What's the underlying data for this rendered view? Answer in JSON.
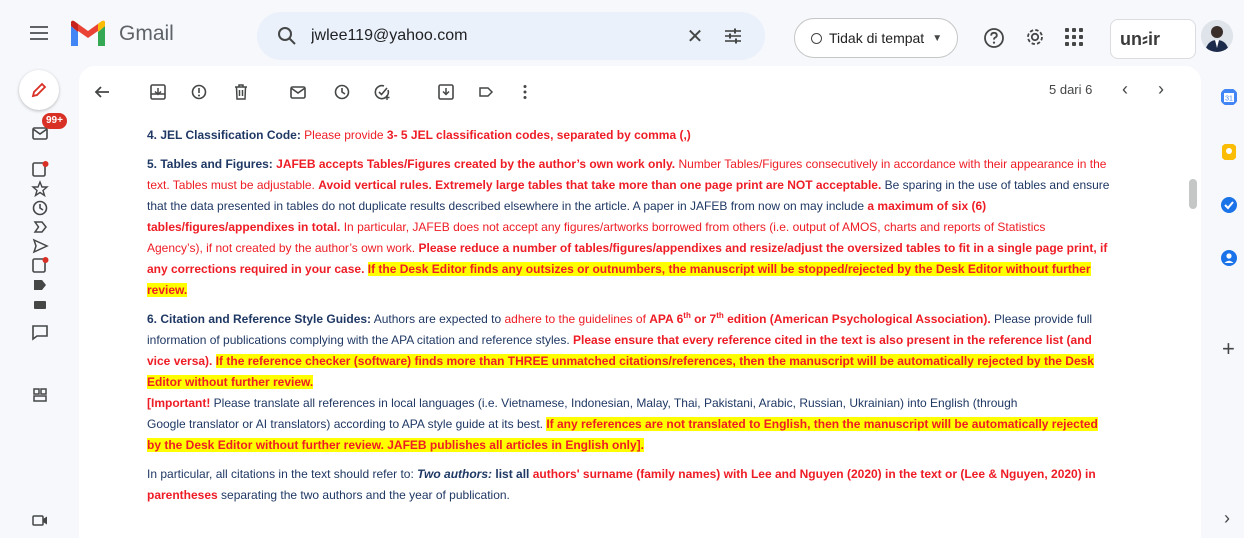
{
  "app": {
    "title": "Gmail"
  },
  "search": {
    "value": "jwlee119@yahoo.com",
    "clear_glyph": "✕"
  },
  "status": {
    "label": "Tidak di tempat",
    "caret": "▼"
  },
  "org_logo_text": "un⸗ir",
  "rail": {
    "badge": "99+"
  },
  "pager": {
    "label": "5 dari 6",
    "prev": "‹",
    "next": "›"
  },
  "colors": {
    "accent_red": "#ee1c25",
    "highlight": "#ffff00",
    "navy": "#1f3864",
    "brand_red": "#ea4335"
  },
  "icons": {
    "topbar": [
      "menu-icon",
      "gmail-logo",
      "search-icon",
      "close-icon",
      "tune-icon",
      "help-icon",
      "settings-icon",
      "apps-icon",
      "avatar"
    ],
    "rail": [
      "pencil-icon",
      "inbox-icon",
      "important-icon",
      "star-icon",
      "clock-icon",
      "label-icon",
      "send-icon",
      "drafts-icon",
      "tag-icon",
      "chat-icon",
      "spaces-icon",
      "video-icon"
    ],
    "toolbar": [
      "back-icon",
      "archive-icon",
      "report-spam-icon",
      "delete-icon",
      "mark-unread-icon",
      "snooze-icon",
      "add-task-icon",
      "move-to-icon",
      "labels-icon",
      "more-icon"
    ],
    "side": [
      "calendar-icon",
      "keep-icon",
      "tasks-icon",
      "contacts-icon",
      "plus-icon",
      "chevron-right-icon"
    ]
  },
  "content": {
    "s4": {
      "head": "4. JEL Classification Code:",
      "t1": " Please provide ",
      "t2": "3- 5 JEL classification codes, separated by comma (,)"
    },
    "s5": {
      "l1": [
        {
          "t": "5. Tables and Figures: ",
          "s": "b navy"
        },
        {
          "t": "JAFEB accepts Tables/Figures created by the author’s own work only.",
          "s": "b red"
        },
        {
          "t": " Number Tables/Figures consecutively in accordance with their appearance in the",
          "s": "red"
        }
      ],
      "l2": [
        {
          "t": "text. Tables must be adjustable. ",
          "s": "red"
        },
        {
          "t": "Avoid vertical rules. Extremely large tables that take more than one page print are NOT acceptable.",
          "s": "b red"
        },
        {
          "t": " Be sparing in the use of tables and ensure",
          "s": "navy"
        }
      ],
      "l3": [
        {
          "t": "that the data presented in tables do not duplicate results described elsewhere in the article. A paper in JAFEB from now on may include ",
          "s": "navy"
        },
        {
          "t": "a maximum of six (6)",
          "s": "b red"
        }
      ],
      "l4": [
        {
          "t": "tables/figures/appendixes in total.",
          "s": "b red"
        },
        {
          "t": " In particular, JAFEB does not accept any figures/artworks borrowed from others (i.e. output of AMOS, charts and reports of Statistics",
          "s": "red"
        }
      ],
      "l5": [
        {
          "t": "Agency’s), if not created by the author’s own work. ",
          "s": "red"
        },
        {
          "t": "Please reduce a number of tables/figures/appendixes and resize/adjust the oversized tables to fit in a single page print, if",
          "s": "b red"
        }
      ],
      "l6": [
        {
          "t": "any corrections required in your case. ",
          "s": "b red"
        },
        {
          "t": "If the Desk Editor finds any outsizes or outnumbers, the manuscript will be stopped/rejected by the Desk Editor without further",
          "s": "b red hl"
        }
      ],
      "l7": [
        {
          "t": "review.",
          "s": "b red hl"
        }
      ]
    },
    "s6": {
      "l1a": "6. Citation and Reference Style Guides:",
      "l1b": " Authors are expected to ",
      "l1c": "adhere to the guidelines of ",
      "l1d": "APA 6",
      "l1e": "th",
      "l1f": " or 7",
      "l1g": "th",
      "l1h": " edition (American Psychological Association).",
      "l1i": " Please provide full",
      "l2a": "information of publications complying with the APA citation and reference styles. ",
      "l2b": "Please ensure that every reference cited in the text is also present in the reference list (and",
      "l3a": "vice versa). ",
      "l3b": "If the reference checker (software) finds more than THREE unmatched citations/references, then the manuscript will be automatically rejected by the Desk",
      "l4a": "Editor without further review.",
      "l5a": "[Important!",
      "l5b": " Please translate all references in local languages (i.e. Vietnamese, Indonesian, Malay, Thai, Pakistani, Arabic, Russian, Ukrainian) into English (through",
      "l6a": "Google translator or AI translators) according to APA style guide at its best. ",
      "l6b": "If any references are not translated to English, then the manuscript will be automatically rejected",
      "l7a": "by the Desk Editor without further review. JAFEB publishes all articles in English only]."
    },
    "s7": {
      "l1a": "In particular, all citations in the text should refer to: ",
      "l1b": "Two authors:",
      "l1c": " list all ",
      "l1d": "authors' surname (family names) with Lee and Nguyen (2020) in the text or (Lee & Nguyen, 2020) in",
      "l2a": "parentheses",
      "l2b": " separating the two authors and the year of publication."
    }
  }
}
